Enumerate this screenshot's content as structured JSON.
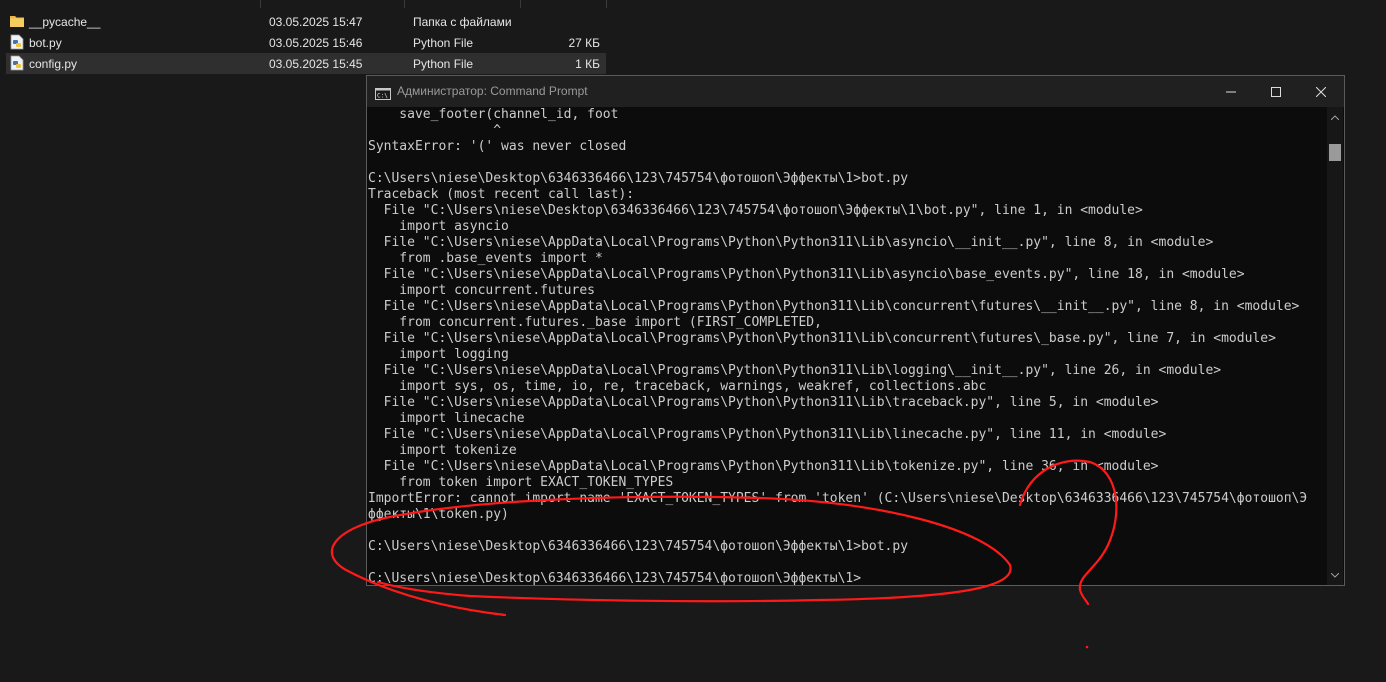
{
  "explorer": {
    "files": [
      {
        "name": "__pycache__",
        "date": "03.05.2025 15:47",
        "type": "Папка с файлами",
        "size": "",
        "icon": "folder-icon"
      },
      {
        "name": "bot.py",
        "date": "03.05.2025 15:46",
        "type": "Python File",
        "size": "27 КБ",
        "icon": "python-file-icon"
      },
      {
        "name": "config.py",
        "date": "03.05.2025 15:45",
        "type": "Python File",
        "size": "1 КБ",
        "icon": "python-file-icon"
      }
    ]
  },
  "cmd_window": {
    "title": "Администратор: Command Prompt",
    "buttons": {
      "minimize": "minimize-icon",
      "maximize": "maximize-icon",
      "close": "close-icon"
    },
    "lines": [
      "    save_footer(channel_id, foot",
      "                ^",
      "SyntaxError: '(' was never closed",
      "",
      "C:\\Users\\niese\\Desktop\\6346336466\\123\\745754\\фотошоп\\Эффекты\\1>bot.py",
      "Traceback (most recent call last):",
      "  File \"C:\\Users\\niese\\Desktop\\6346336466\\123\\745754\\фотошоп\\Эффекты\\1\\bot.py\", line 1, in <module>",
      "    import asyncio",
      "  File \"C:\\Users\\niese\\AppData\\Local\\Programs\\Python\\Python311\\Lib\\asyncio\\__init__.py\", line 8, in <module>",
      "    from .base_events import *",
      "  File \"C:\\Users\\niese\\AppData\\Local\\Programs\\Python\\Python311\\Lib\\asyncio\\base_events.py\", line 18, in <module>",
      "    import concurrent.futures",
      "  File \"C:\\Users\\niese\\AppData\\Local\\Programs\\Python\\Python311\\Lib\\concurrent\\futures\\__init__.py\", line 8, in <module>",
      "    from concurrent.futures._base import (FIRST_COMPLETED,",
      "  File \"C:\\Users\\niese\\AppData\\Local\\Programs\\Python\\Python311\\Lib\\concurrent\\futures\\_base.py\", line 7, in <module>",
      "    import logging",
      "  File \"C:\\Users\\niese\\AppData\\Local\\Programs\\Python\\Python311\\Lib\\logging\\__init__.py\", line 26, in <module>",
      "    import sys, os, time, io, re, traceback, warnings, weakref, collections.abc",
      "  File \"C:\\Users\\niese\\AppData\\Local\\Programs\\Python\\Python311\\Lib\\traceback.py\", line 5, in <module>",
      "    import linecache",
      "  File \"C:\\Users\\niese\\AppData\\Local\\Programs\\Python\\Python311\\Lib\\linecache.py\", line 11, in <module>",
      "    import tokenize",
      "  File \"C:\\Users\\niese\\AppData\\Local\\Programs\\Python\\Python311\\Lib\\tokenize.py\", line 36, in <module>",
      "    from token import EXACT_TOKEN_TYPES",
      "ImportError: cannot import name 'EXACT_TOKEN_TYPES' from 'token' (C:\\Users\\niese\\Desktop\\6346336466\\123\\745754\\фотошоп\\Э",
      "ффекты\\1\\token.py)",
      "",
      "C:\\Users\\niese\\Desktop\\6346336466\\123\\745754\\фотошоп\\Эффекты\\1>bot.py",
      "",
      "C:\\Users\\niese\\Desktop\\6346336466\\123\\745754\\фотошоп\\Эффекты\\1>"
    ]
  },
  "colors": {
    "background": "#191919",
    "console_bg": "#0c0c0c",
    "console_text": "#cccccc",
    "annotation": "#ff1a1a",
    "selected_row": "#2f2f2f"
  }
}
